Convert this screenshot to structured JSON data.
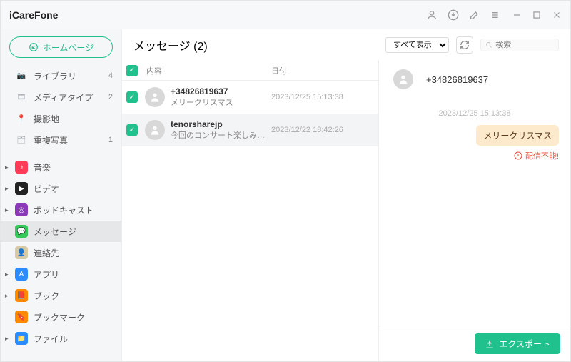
{
  "app_title": "iCareFone",
  "home_label": "ホームページ",
  "sidebar": {
    "items": [
      {
        "label": "ライブラリ",
        "count": "4",
        "icon": "📷",
        "bg": "#fff"
      },
      {
        "label": "メディアタイプ",
        "count": "2",
        "icon": "🎞",
        "bg": "#fff"
      },
      {
        "label": "撮影地",
        "count": "",
        "icon": "📍",
        "bg": "#fff"
      },
      {
        "label": "重複写真",
        "count": "1",
        "icon": "🗂",
        "bg": "#fff"
      }
    ],
    "sections": [
      {
        "label": "音楽",
        "icon": "♪",
        "bg": "#ff3b57",
        "arrow": true
      },
      {
        "label": "ビデオ",
        "icon": "▶",
        "bg": "#222",
        "arrow": true
      },
      {
        "label": "ポッドキャスト",
        "icon": "◎",
        "bg": "#8a3ab9",
        "arrow": true
      },
      {
        "label": "メッセージ",
        "icon": "💬",
        "bg": "#34c759",
        "active": true
      },
      {
        "label": "連絡先",
        "icon": "👤",
        "bg": "#d6cba6"
      },
      {
        "label": "アプリ",
        "icon": "A",
        "bg": "#2b8cff",
        "arrow": true
      },
      {
        "label": "ブック",
        "icon": "📕",
        "bg": "#ff8a00",
        "arrow": true
      },
      {
        "label": "ブックマーク",
        "icon": "🔖",
        "bg": "#ff8a00"
      },
      {
        "label": "ファイル",
        "icon": "📁",
        "bg": "#2b8cff",
        "arrow": true
      }
    ]
  },
  "content": {
    "title": "メッセージ (2)",
    "dropdown": "すべて表示",
    "search_placeholder": "検索",
    "columns": {
      "content": "内容",
      "date": "日付"
    },
    "rows": [
      {
        "title": "+34826819637",
        "preview": "メリークリスマス",
        "date": "2023/12/25 15:13:38",
        "checked": true
      },
      {
        "title": "tenorsharejp",
        "preview": "今回のコンサート楽しみに待っ...",
        "date": "2023/12/22 18:42:26",
        "checked": true,
        "selected": true
      }
    ]
  },
  "detail": {
    "name": "+34826819637",
    "chat_time": "2023/12/25 15:13:38",
    "bubble_text": "メリークリスマス",
    "deliver_fail": "配信不能!"
  },
  "export_label": "エクスポート"
}
